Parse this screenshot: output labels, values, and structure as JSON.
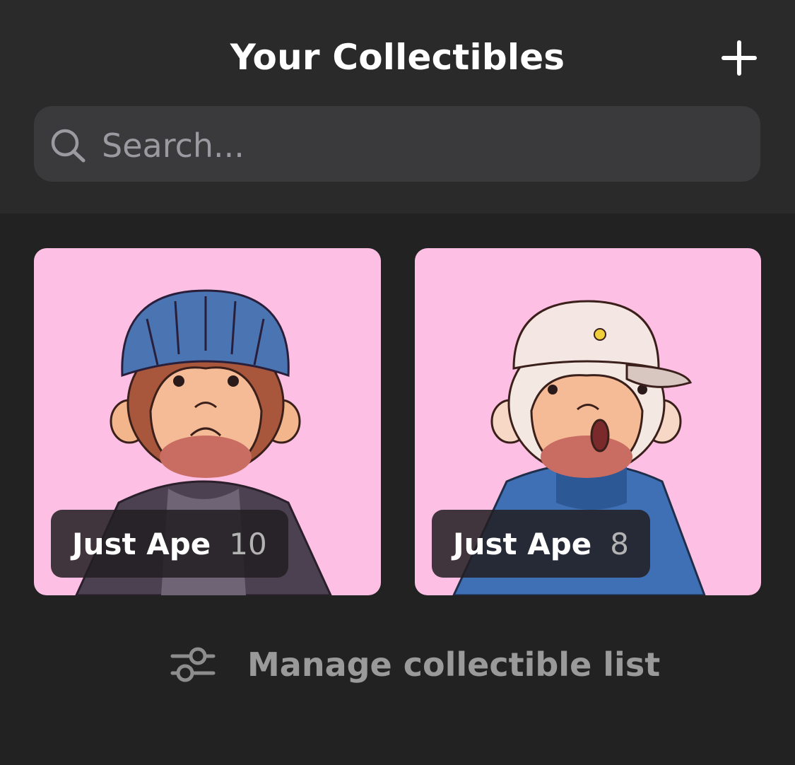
{
  "header": {
    "title": "Your Collectibles",
    "add_icon": "plus-icon"
  },
  "search": {
    "placeholder": "Search...",
    "value": "",
    "icon": "search-icon"
  },
  "collectibles": [
    {
      "name": "Just Ape",
      "number": "10",
      "background": "#fdc0e4",
      "art": "ape-blue-beanie"
    },
    {
      "name": "Just Ape",
      "number": "8",
      "background": "#fdc0e4",
      "art": "ape-white-cap"
    }
  ],
  "manage": {
    "label": "Manage collectible list",
    "icon": "sliders-icon"
  },
  "colors": {
    "background": "#222222",
    "header_background": "#2a2a2b",
    "search_background": "#3a3a3d",
    "card_pink": "#fdc0e4"
  }
}
